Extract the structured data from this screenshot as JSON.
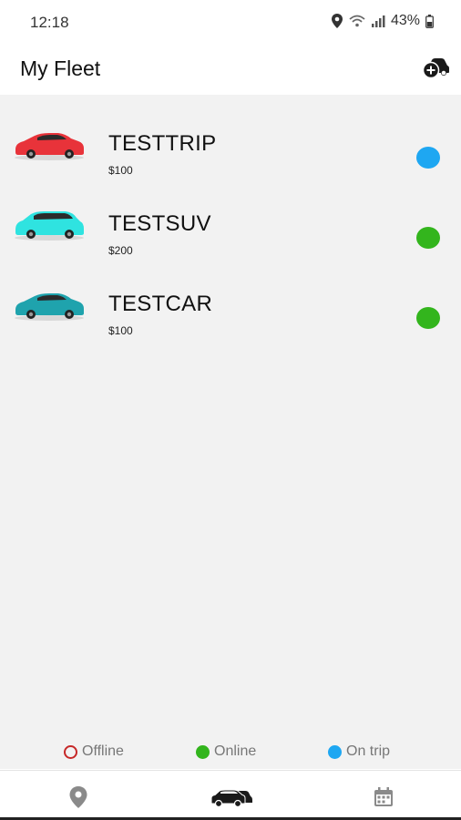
{
  "status_bar": {
    "time": "12:18",
    "battery": "43%"
  },
  "app_bar": {
    "title": "My Fleet",
    "add_icon": "add-car-icon"
  },
  "vehicles": [
    {
      "name": "TESTTRIP",
      "price": "$100",
      "car_color": "#e8333a",
      "status": "On trip",
      "status_color": "#1ea7f2"
    },
    {
      "name": "TESTSUV",
      "price": "$200",
      "car_color": "#2fe3e0",
      "status": "Online",
      "status_color": "#33b51d"
    },
    {
      "name": "TESTCAR",
      "price": "$100",
      "car_color": "#1fa3ad",
      "status": "Online",
      "status_color": "#33b51d"
    }
  ],
  "legend": {
    "offline": {
      "label": "Offline",
      "color": "#c62828"
    },
    "online": {
      "label": "Online",
      "color": "#33b51d"
    },
    "on_trip": {
      "label": "On trip",
      "color": "#1ea7f2"
    }
  },
  "bottom_nav": [
    {
      "name": "map",
      "icon": "map-pin-icon"
    },
    {
      "name": "fleet",
      "icon": "fleet-car-icon"
    },
    {
      "name": "calendar",
      "icon": "calendar-icon"
    }
  ]
}
